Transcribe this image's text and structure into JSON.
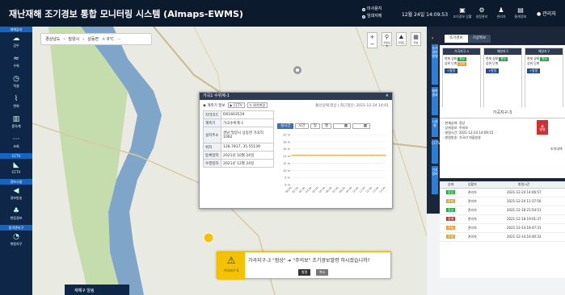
{
  "header": {
    "title": "재난재해 조기경보 통합 모니터링 시스템 (Almaps-EWMS)",
    "legend": [
      "미사용지",
      "임대지에"
    ],
    "clock": "12월 24일 14:09:53",
    "icons": [
      {
        "glyph": "▣",
        "label": "조기경보 상황"
      },
      {
        "glyph": "⚙",
        "label": "설정관리"
      },
      {
        "glyph": "♟",
        "label": "관리자"
      },
      {
        "glyph": "▤",
        "label": "통계정보"
      }
    ],
    "user": "관리자"
  },
  "sidebar": [
    {
      "section": "재해감지",
      "items": [
        {
          "glyph": "☁",
          "label": "강우"
        },
        {
          "glyph": "≈",
          "label": "수위"
        },
        {
          "glyph": "◷",
          "label": "적설"
        },
        {
          "glyph": "⌇",
          "label": "변위"
        },
        {
          "glyph": "▥",
          "label": "풍속계"
        },
        {
          "glyph": "⋯",
          "label": "조회"
        }
      ]
    },
    {
      "section": "CCTV",
      "items": [
        {
          "glyph": "◣",
          "label": "CCTV"
        }
      ]
    },
    {
      "section": "경보시설",
      "items": [
        {
          "glyph": "◀",
          "label": "경보방송"
        },
        {
          "glyph": "♣",
          "label": "현장경보"
        }
      ]
    },
    {
      "section": "원격관리구",
      "items": [
        {
          "glyph": "◔",
          "label": "위험지구"
        }
      ]
    }
  ],
  "map": {
    "breadcrumb": [
      "경상남도",
      "밀양시",
      "상동면"
    ],
    "weather": "☼ 6℃",
    "tools": [
      {
        "glyph": "+",
        "label": ""
      },
      {
        "glyph": "⚲",
        "label": "주변검색"
      },
      {
        "glyph": "⛰",
        "label": "지형도"
      },
      {
        "glyph": "▦",
        "label": "위성"
      }
    ],
    "minus": "−",
    "bottom_tab": "재해구 알림"
  },
  "popup": {
    "title": "가곡1 수위계-1",
    "radio": "계측기 정보",
    "btn_cctv": "CCTV",
    "btn_link": "위치변경",
    "status": "통신상태:정상 | 최근갱신: 2021-12-24 14:01",
    "rows": [
      {
        "k": "지역코드",
        "v": "D01603519"
      },
      {
        "k": "계측기",
        "v": "가곡수위계-1"
      },
      {
        "k": "설치주소",
        "v": "경남 밀양시 상동면 가곡리 1062"
      },
      {
        "k": "위치",
        "v": "128.7817, 35.55139"
      },
      {
        "k": "등록일자",
        "v": "2021년 10월 24일"
      },
      {
        "k": "수정일자",
        "v": "2021년 12월 24일"
      }
    ],
    "chart_tabs": [
      "실시간",
      "시간",
      "일",
      "월"
    ]
  },
  "chart_data": {
    "type": "line",
    "yticks": [
      "20 m",
      "18 m",
      "16 m",
      "14 m",
      "12 m",
      "10 m",
      "8 m",
      "6 m"
    ],
    "xticks": [
      "00:00",
      "01:00",
      "02:00",
      "03:00",
      "04:00",
      "05:00",
      "06:00",
      "07:00",
      "08:00",
      "09:00",
      "10:00",
      "11:00",
      "12:00",
      "13:00",
      "14:00"
    ],
    "ylim": [
      6,
      20
    ],
    "series": [
      {
        "values": [
          14.2,
          14.2,
          14.2,
          14.2,
          14.2,
          14.2,
          14.2,
          14.2,
          14.2,
          14.2,
          14.2,
          14.2,
          14.2,
          14.2,
          14.2
        ],
        "color": "#e3a43a"
      }
    ]
  },
  "alert": {
    "region": "가곡지구-3",
    "message": "가곡지구-3 \"점상\" ➔ \"주의보\" 조기경보발령 하시겠습니까?",
    "confirm": "발령",
    "cancel": "취소"
  },
  "right": {
    "tabs": [
      "조기경보",
      "기상특보"
    ],
    "vtabs": [
      "조기경보발령",
      "예측결과",
      "시설물",
      "CCTV",
      "기상정보"
    ],
    "cards": [
      {
        "title": "가곡지구-3",
        "status": "평상",
        "btn": "+발령"
      },
      {
        "title": "해양지구",
        "status": "평상",
        "btn": "+발령"
      },
      {
        "title": "해양지구",
        "status": "평상",
        "btn": "+발령"
      }
    ],
    "detail": {
      "title": "가곡지구-3",
      "lines": [
        "· 현재상태: 정상",
        "· 상위경보: 주의보",
        "· 발령시간: 2021-12-24 14:09:15",
        "· 발령방송: 가곡리 마을방송"
      ],
      "raise": "발령",
      "link": "조치내역"
    },
    "history_headers": [
      "상태",
      "상황자",
      "발령시간"
    ],
    "history": [
      {
        "st": "정상",
        "color": "#27a845",
        "who": "관리자",
        "time": "2021-12-24 14:06:57"
      },
      {
        "st": "주의",
        "color": "#e3a43a",
        "who": "관리자",
        "time": "2021-12-24 11:37:56"
      },
      {
        "st": "정상",
        "color": "#27a845",
        "who": "관리자",
        "time": "2021-12-18 21:54:51"
      },
      {
        "st": "경계",
        "color": "#d32f2f",
        "who": "관리자",
        "time": "2021-12-18 19:01:37"
      },
      {
        "st": "주의",
        "color": "#e3a43a",
        "who": "관리자",
        "time": "2021-12-14 18:47:31"
      },
      {
        "st": "주의",
        "color": "#e3a43a",
        "who": "관리자",
        "time": "2021-12-14 16:40:33"
      }
    ]
  }
}
